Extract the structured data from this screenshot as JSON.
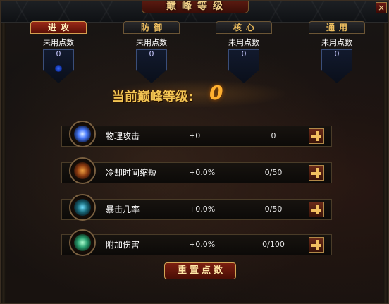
{
  "window": {
    "title": "巅峰等级",
    "close_label": "×"
  },
  "tabs": [
    {
      "label": "进攻",
      "active": true
    },
    {
      "label": "防御",
      "active": false
    },
    {
      "label": "核心",
      "active": false
    },
    {
      "label": "通用",
      "active": false
    }
  ],
  "point_columns": [
    {
      "label": "未用点数",
      "value": "0"
    },
    {
      "label": "未用点数",
      "value": "0"
    },
    {
      "label": "未用点数",
      "value": "0"
    },
    {
      "label": "未用点数",
      "value": "0"
    }
  ],
  "banner": {
    "label": "当前巅峰等级:",
    "level": "0"
  },
  "stats": [
    {
      "name": "物理攻击",
      "bonus": "+0",
      "progress": "0",
      "icon": "physical-attack-icon"
    },
    {
      "name": "冷却时间缩短",
      "bonus": "+0.0%",
      "progress": "0/50",
      "icon": "cooldown-icon"
    },
    {
      "name": "暴击几率",
      "bonus": "+0.0%",
      "progress": "0/50",
      "icon": "crit-chance-icon"
    },
    {
      "name": "附加伤害",
      "bonus": "+0.0%",
      "progress": "0/100",
      "icon": "extra-damage-icon"
    }
  ],
  "reset_button": {
    "label": "重置点数"
  },
  "colors": {
    "accent_gold": "#f2c453",
    "active_tab": "#9b2a18",
    "point_orb": "#3a6cff"
  }
}
